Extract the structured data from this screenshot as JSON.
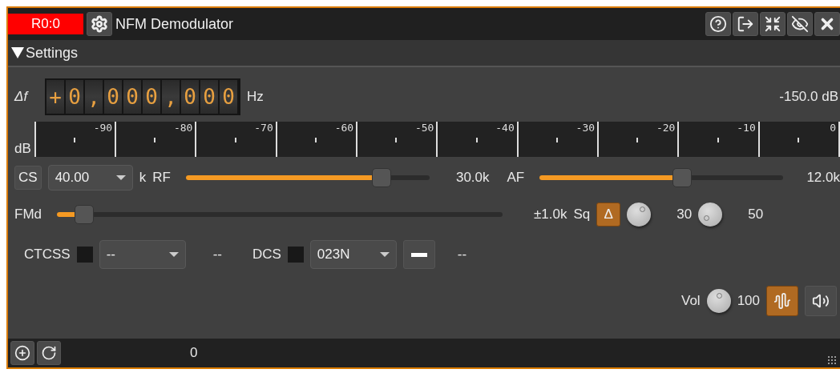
{
  "title_bar": {
    "channel": "R0:0",
    "title": "NFM Demodulator"
  },
  "settings": {
    "label": "Settings",
    "expanded": true
  },
  "frequency": {
    "label": "Δf",
    "digits": [
      "+",
      "0",
      ",",
      "0",
      "0",
      "0",
      ",",
      "0",
      "0",
      "0"
    ],
    "unit": "Hz",
    "power": "-150.0 dB"
  },
  "meter": {
    "label": "dB",
    "ticks": [
      "-90",
      "-80",
      "-70",
      "-60",
      "-50",
      "-40",
      "-30",
      "-20",
      "-10",
      "0"
    ]
  },
  "bandwidth_row": {
    "cs_button": "CS",
    "spacing": "40.00",
    "spacing_unit": "k",
    "rf": {
      "label": "RF",
      "level": 0.8,
      "reading": "30.0k"
    },
    "af": {
      "label": "AF",
      "level": 0.58,
      "reading": "12.0k"
    }
  },
  "fm_row": {
    "label": "FMd",
    "level": 0.06,
    "reading": "±1.0k",
    "squelch_label": "Sq",
    "delta_button": {
      "label": "Δ",
      "on": true
    },
    "squelch_threshold": "30",
    "squelch_gate": "50"
  },
  "ctcss": {
    "label": "CTCSS",
    "checked": false,
    "value": "--",
    "detected": "--"
  },
  "dcs": {
    "label": "DCS",
    "checked": false,
    "value": "023N",
    "detected": "--"
  },
  "audio": {
    "label": "Vol",
    "value": "100",
    "filter_on": true
  },
  "status_bar": {
    "value": "0"
  }
}
